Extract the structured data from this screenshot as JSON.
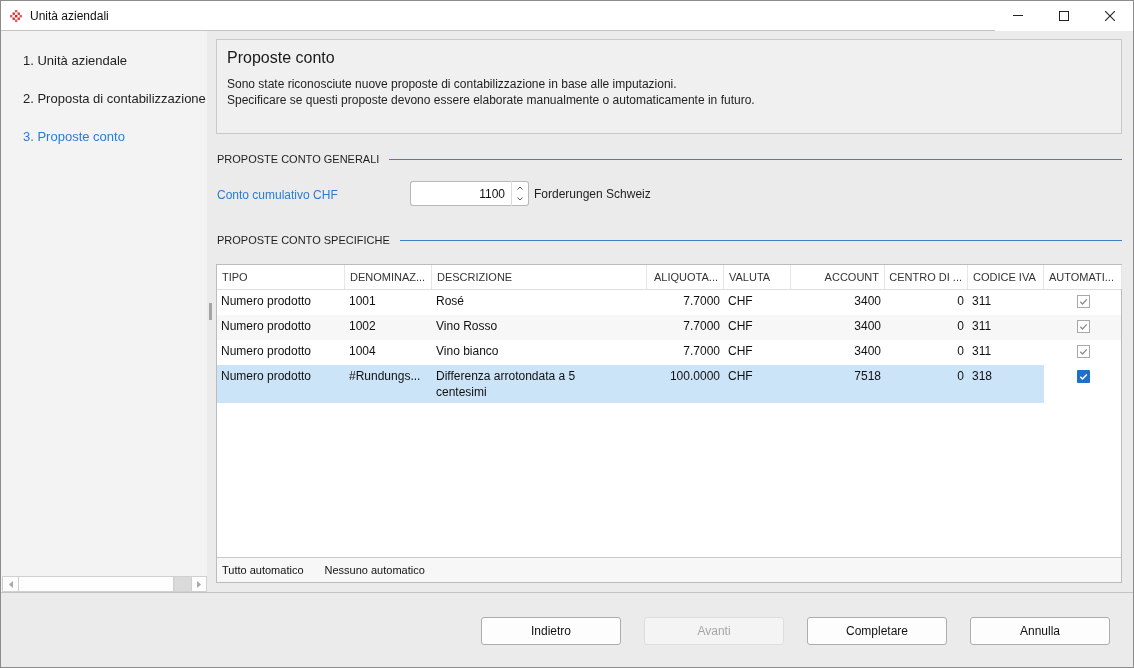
{
  "window": {
    "title": "Unità aziendali"
  },
  "steps": [
    {
      "label": "1. Unità aziendale",
      "selected": false
    },
    {
      "label": "2. Proposta di contabilizzazione",
      "selected": false
    },
    {
      "label": "3. Proposte conto",
      "selected": true
    }
  ],
  "info_panel": {
    "title": "Proposte conto",
    "lines": [
      "Sono state riconosciute nuove proposte di contabilizzazione in base alle imputazioni.",
      "Specificare se questi proposte devono essere elaborate manualmente o automaticamente in futuro."
    ]
  },
  "general_section": {
    "title": "PROPOSTE CONTO GENERALI",
    "field": {
      "label": "Conto cumulativo CHF",
      "value": "1100",
      "description": "Forderungen Schweiz"
    }
  },
  "specific_section": {
    "title": "PROPOSTE CONTO SPECIFICHE",
    "table": {
      "columns": [
        {
          "label": "TIPO",
          "kind": "text"
        },
        {
          "label": "DENOMINAZ...",
          "kind": "text"
        },
        {
          "label": "DESCRIZIONE",
          "kind": "text"
        },
        {
          "label": "ALIQUOTA...",
          "kind": "number"
        },
        {
          "label": "VALUTA",
          "kind": "text"
        },
        {
          "label": "ACCOUNT",
          "kind": "number"
        },
        {
          "label": "CENTRO DI ...",
          "kind": "number"
        },
        {
          "label": "CODICE IVA",
          "kind": "text"
        },
        {
          "label": "AUTOMATI...",
          "kind": "check"
        }
      ],
      "rows": [
        {
          "selected": false,
          "cells": [
            "Numero prodotto",
            "1001",
            "Rosé",
            "7.7000",
            "CHF",
            "3400",
            "0",
            "311"
          ],
          "checked": true
        },
        {
          "selected": false,
          "cells": [
            "Numero prodotto",
            "1002",
            "Vino Rosso",
            "7.7000",
            "CHF",
            "3400",
            "0",
            "311"
          ],
          "checked": true
        },
        {
          "selected": false,
          "cells": [
            "Numero prodotto",
            "1004",
            "Vino bianco",
            "7.7000",
            "CHF",
            "3400",
            "0",
            "311"
          ],
          "checked": true
        },
        {
          "selected": true,
          "cells": [
            "Numero prodotto",
            "#Rundungs...",
            "Differenza arrotondata a 5 centesimi",
            "100.0000",
            "CHF",
            "7518",
            "0",
            "318"
          ],
          "checked": true
        }
      ],
      "footer_actions": [
        "Tutto automatico",
        "Nessuno automatico"
      ]
    }
  },
  "buttons": [
    {
      "label": "Indietro",
      "disabled": false
    },
    {
      "label": "Avanti",
      "disabled": true
    },
    {
      "label": "Completare",
      "disabled": false
    },
    {
      "label": "Annulla",
      "disabled": false
    }
  ]
}
